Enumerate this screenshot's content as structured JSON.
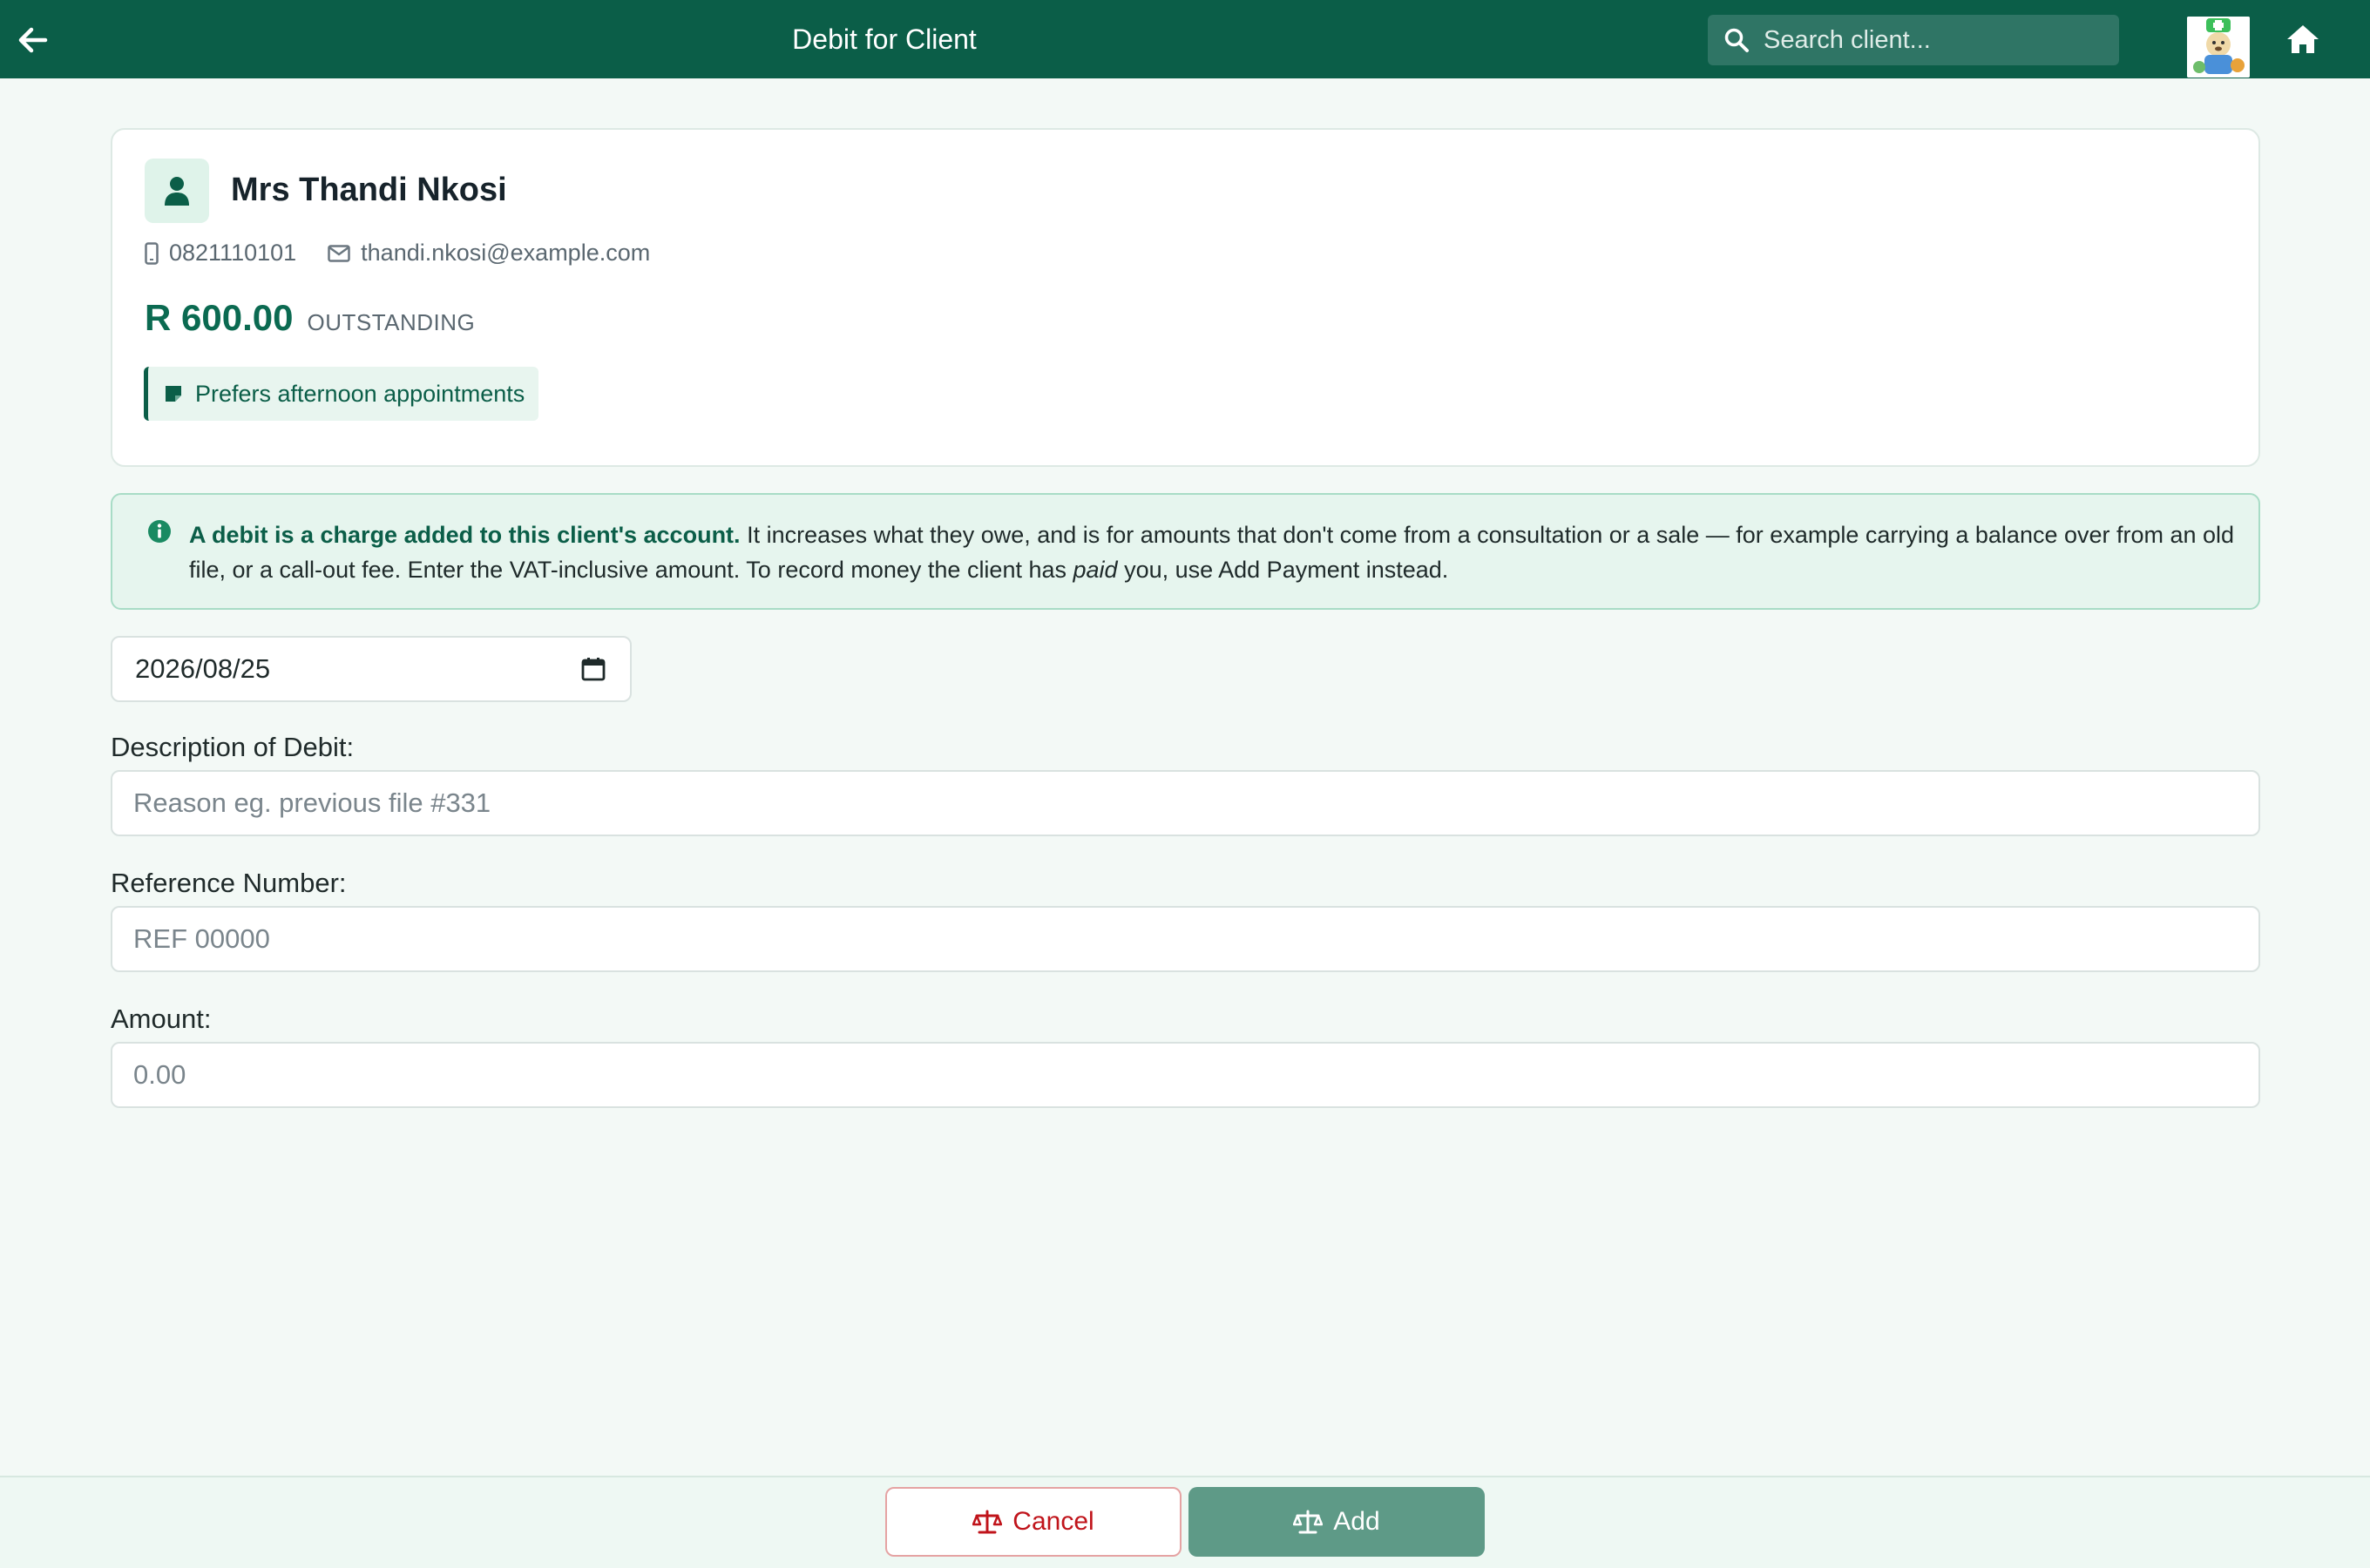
{
  "header": {
    "title": "Debit for Client",
    "search_placeholder": "Search client..."
  },
  "client": {
    "name": "Mrs Thandi Nkosi",
    "phone": "0821110101",
    "email": "thandi.nkosi@example.com",
    "balance_amount": "R 600.00",
    "balance_label": "OUTSTANDING",
    "note": "Prefers afternoon appointments"
  },
  "info": {
    "bold": "A debit is a charge added to this client's account.",
    "text_before_em": " It increases what they owe, and is for amounts that don't come from a consultation or a sale — for example carrying a balance over from an old file, or a call-out fee. Enter the VAT-inclusive amount. To record money the client has ",
    "em": "paid",
    "text_after_em": " you, use Add Payment instead."
  },
  "form": {
    "date_value": "2026/08/25",
    "description_label": "Description of Debit:",
    "description_placeholder": "Reason eg. previous file #331",
    "reference_label": "Reference Number:",
    "reference_placeholder": "REF 00000",
    "amount_label": "Amount:",
    "amount_placeholder": "0.00"
  },
  "footer": {
    "cancel_label": "Cancel",
    "add_label": "Add"
  },
  "colors": {
    "header": "#0b5e48",
    "accent": "#0b6a51",
    "cancel_red": "#c0141b",
    "add_button": "#5e9a87"
  }
}
